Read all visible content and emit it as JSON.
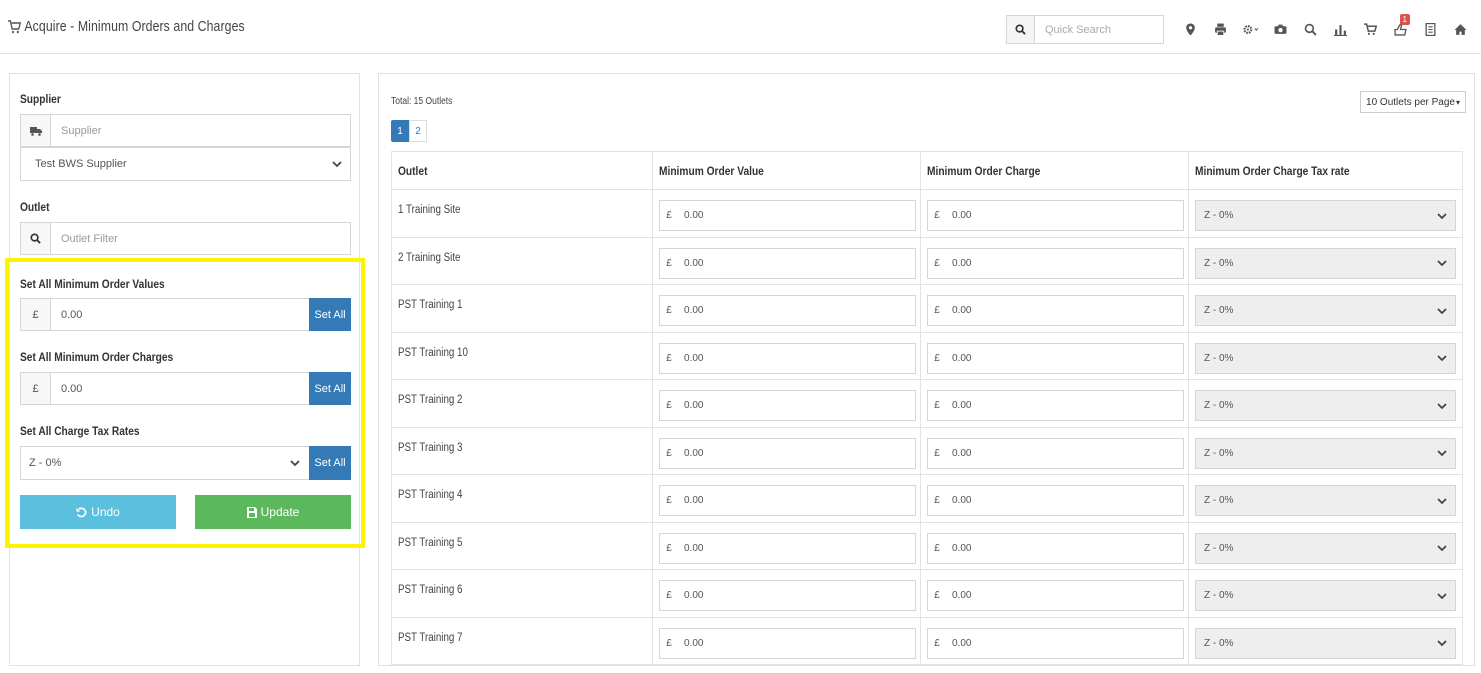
{
  "header": {
    "title": "Acquire - Minimum Orders and Charges",
    "search_placeholder": "Quick Search",
    "icons": [
      "map-marker-icon",
      "printer-icon",
      "settings-icon",
      "camera-icon",
      "search-icon",
      "bar-chart-icon",
      "cart-icon",
      "notifications-icon",
      "document-icon",
      "home-icon",
      "power-icon"
    ],
    "notification_count": "1"
  },
  "left": {
    "supplier_label": "Supplier",
    "supplier_placeholder": "Supplier",
    "supplier_selected": "Test BWS Supplier",
    "outlet_label": "Outlet",
    "outlet_placeholder": "Outlet Filter",
    "set_values_label": "Set All Minimum Order Values",
    "set_values_value": "0.00",
    "set_charges_label": "Set All Minimum Order Charges",
    "set_charges_value": "0.00",
    "set_tax_label": "Set All Charge Tax Rates",
    "set_tax_selected": "Z - 0%",
    "set_all_label": "Set All",
    "currency": "£",
    "undo_label": "Undo",
    "update_label": "Update"
  },
  "right": {
    "total": "Total: 15 Outlets",
    "per_page": "10 Outlets per Page",
    "pages": [
      "1",
      "2"
    ],
    "active_page": "1",
    "columns": [
      "Outlet",
      "Minimum Order Value",
      "Minimum Order Charge",
      "Minimum Order Charge Tax rate"
    ],
    "rows": [
      {
        "outlet": "1 Training Site",
        "value": "0.00",
        "charge": "0.00",
        "tax": "Z - 0%"
      },
      {
        "outlet": "2 Training Site",
        "value": "0.00",
        "charge": "0.00",
        "tax": "Z - 0%"
      },
      {
        "outlet": "PST Training 1",
        "value": "0.00",
        "charge": "0.00",
        "tax": "Z - 0%"
      },
      {
        "outlet": "PST Training 10",
        "value": "0.00",
        "charge": "0.00",
        "tax": "Z - 0%"
      },
      {
        "outlet": "PST Training 2",
        "value": "0.00",
        "charge": "0.00",
        "tax": "Z - 0%"
      },
      {
        "outlet": "PST Training 3",
        "value": "0.00",
        "charge": "0.00",
        "tax": "Z - 0%"
      },
      {
        "outlet": "PST Training 4",
        "value": "0.00",
        "charge": "0.00",
        "tax": "Z - 0%"
      },
      {
        "outlet": "PST Training 5",
        "value": "0.00",
        "charge": "0.00",
        "tax": "Z - 0%"
      },
      {
        "outlet": "PST Training 6",
        "value": "0.00",
        "charge": "0.00",
        "tax": "Z - 0%"
      },
      {
        "outlet": "PST Training 7",
        "value": "0.00",
        "charge": "0.00",
        "tax": "Z - 0%"
      }
    ]
  },
  "colors": {
    "primary": "#337ab7",
    "info": "#5bc0de",
    "success": "#5cb85c",
    "highlight": "#fff200",
    "badge": "#d9534f"
  }
}
